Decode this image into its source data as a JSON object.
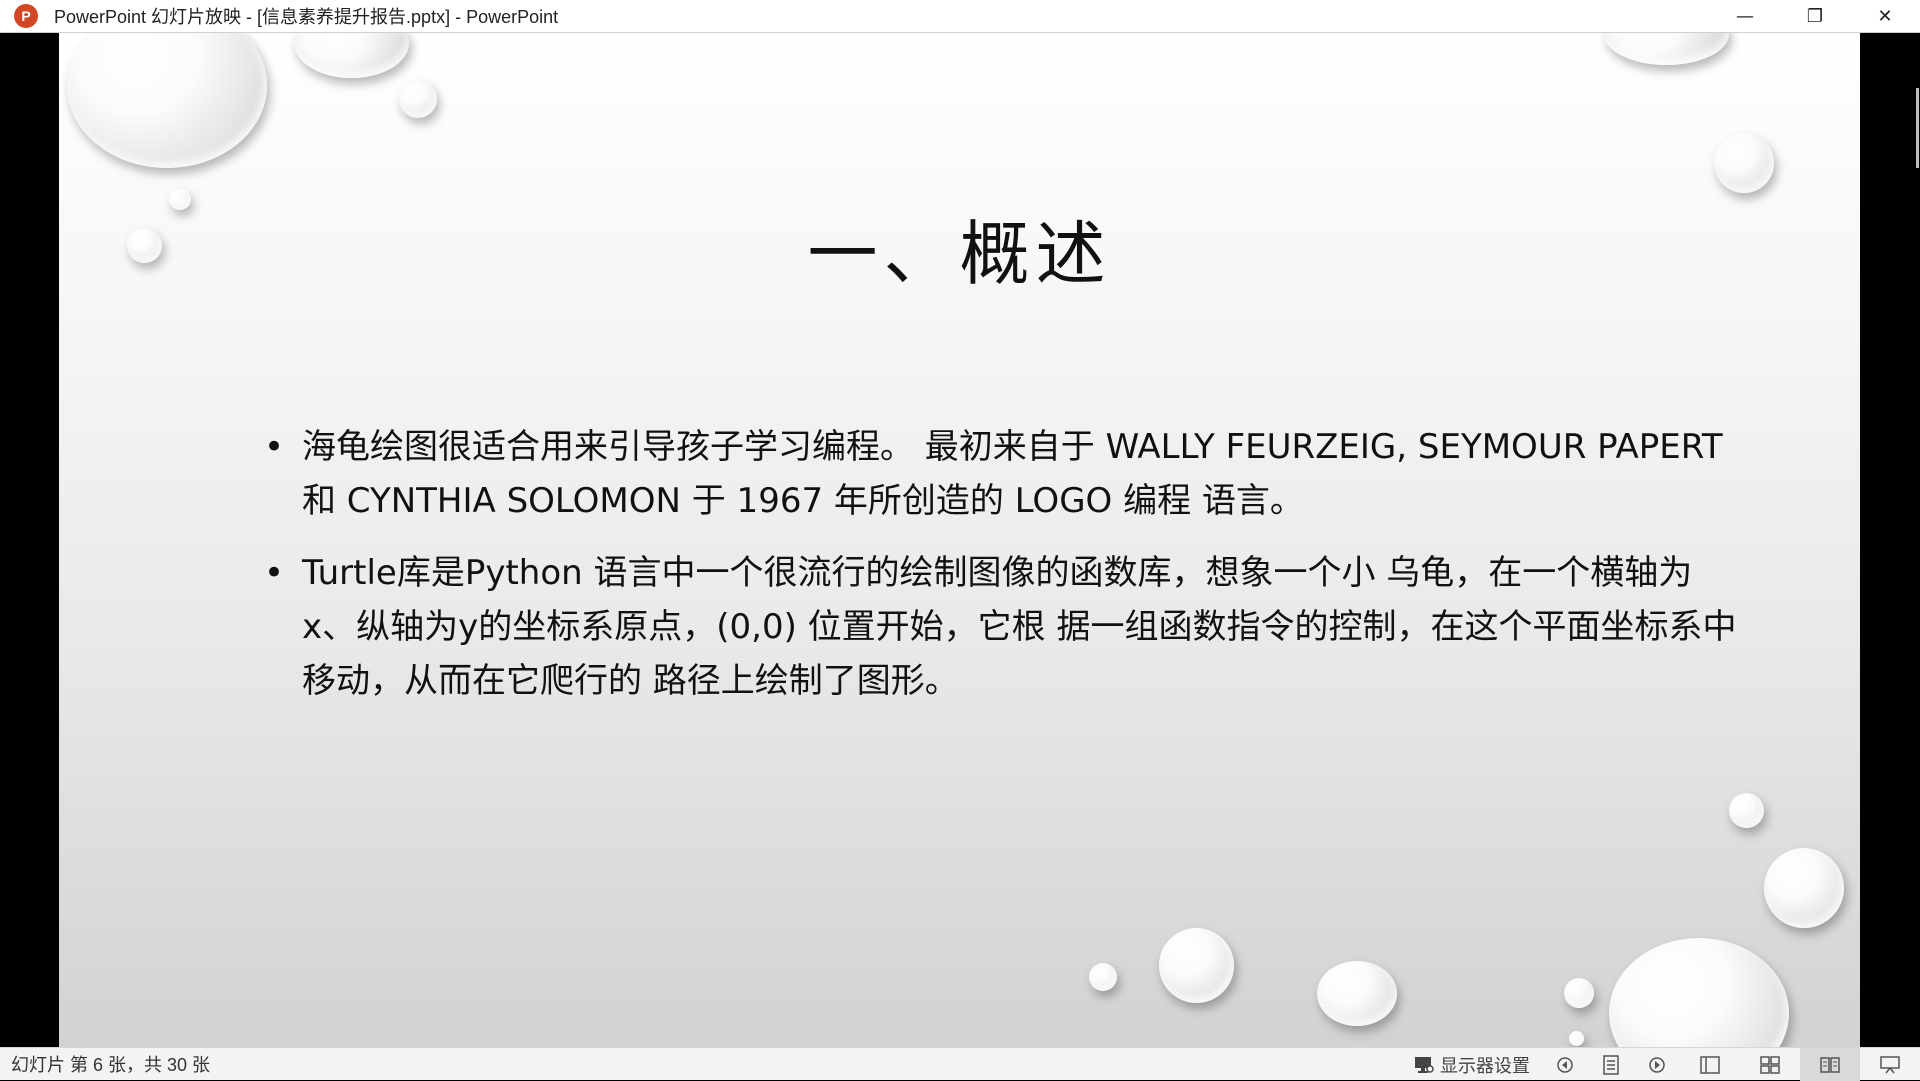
{
  "window": {
    "app_icon": "powerpoint-icon",
    "app_icon_letter": "P",
    "title": "PowerPoint 幻灯片放映 - [信息素养提升报告.pptx] - PowerPoint",
    "controls": {
      "minimize_glyph": "—",
      "restore_glyph": "❐",
      "close_glyph": "✕"
    }
  },
  "slide": {
    "title": "一、概述",
    "bullets": [
      {
        "marker": "•",
        "text": "海龟绘图很适合用来引导孩子学习编程。 最初来自于 WALLY FEURZEIG, SEYMOUR PAPERT 和 CYNTHIA SOLOMON 于 1967 年所创造的 LOGO 编程 语言。"
      },
      {
        "marker": "•",
        "text": "Turtle库是Python 语言中一个很流行的绘制图像的函数库，想象一个小 乌龟，在一个横轴为x、纵轴为y的坐标系原点，(0,0) 位置开始，它根 据一组函数指令的控制，在这个平面坐标系中移动，从而在它爬行的 路径上绘制了图形。"
      }
    ]
  },
  "statusbar": {
    "slide_info": "幻灯片 第 6 张，共 30 张",
    "display_settings_label": "显示器设置",
    "icons": {
      "display": "monitor-icon",
      "prev": "previous-slide-icon",
      "menu": "slide-menu-icon",
      "next": "next-slide-icon",
      "normal": "normal-view-icon",
      "sorter": "slide-sorter-icon",
      "reading": "reading-view-icon",
      "slideshow": "slideshow-icon"
    }
  },
  "colors": {
    "app_accent": "#d24726",
    "slide_text": "#111111"
  }
}
